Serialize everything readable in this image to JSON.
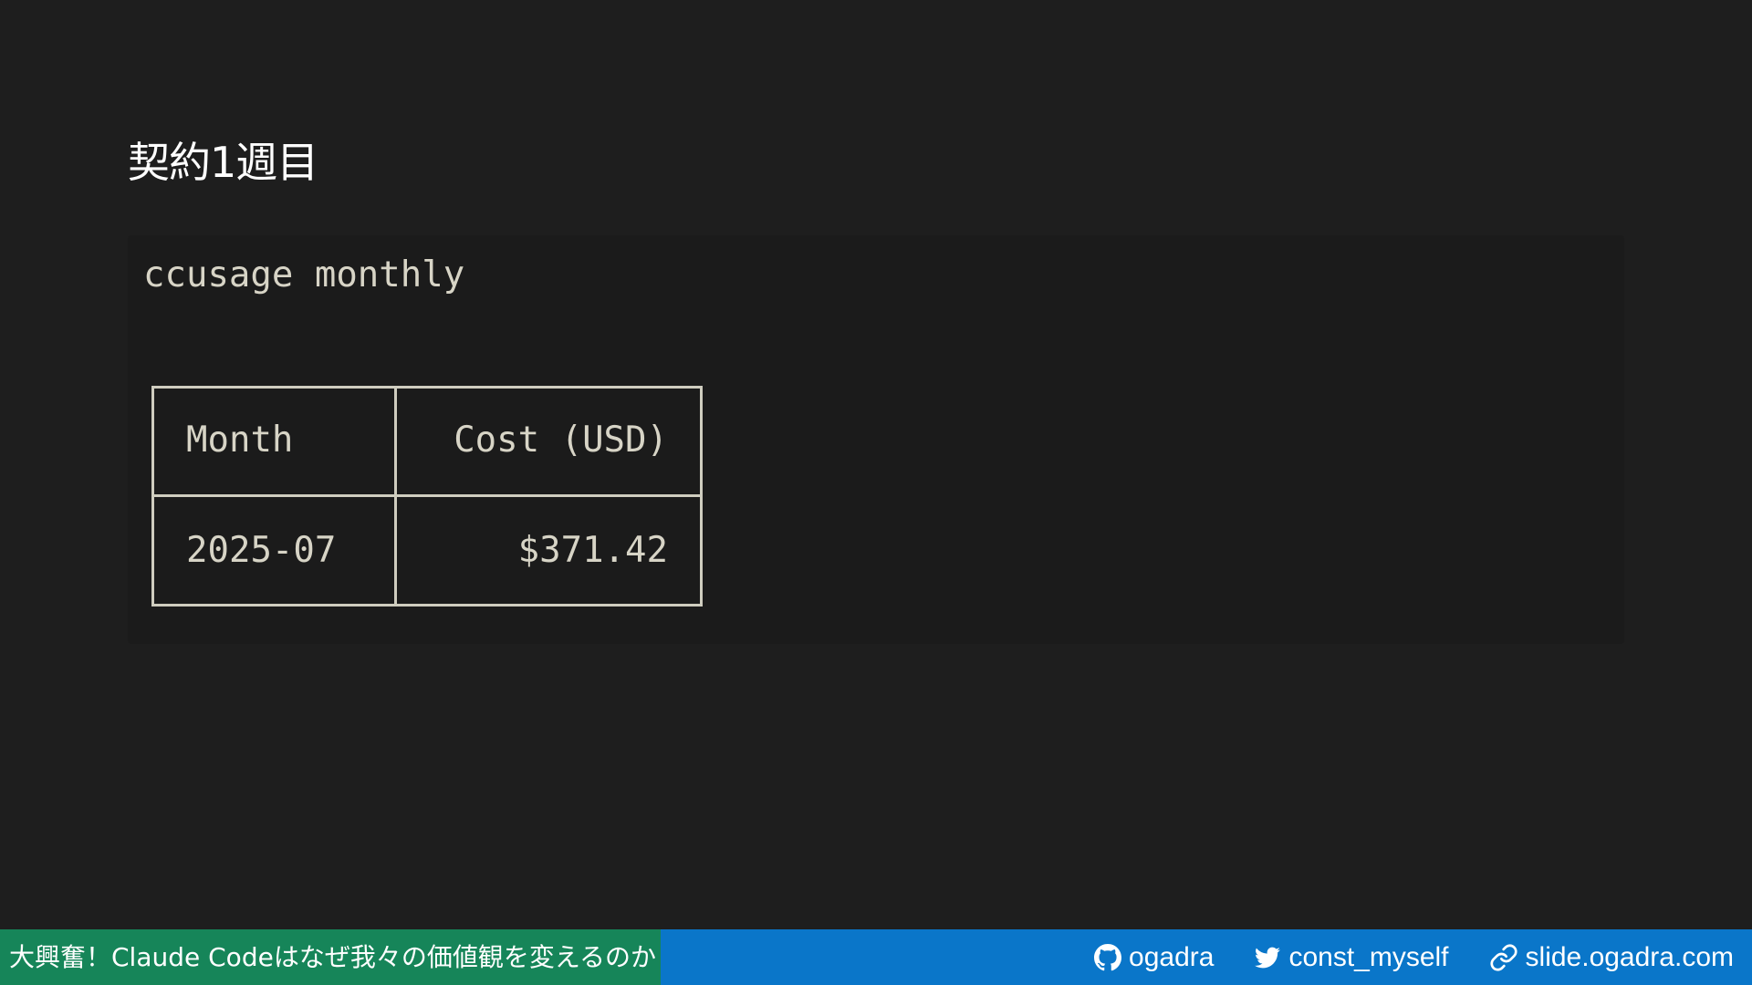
{
  "slide": {
    "title": "契約1週目"
  },
  "code": {
    "command": "ccusage monthly",
    "table": {
      "headers": [
        "Month",
        "Cost (USD)"
      ],
      "rows": [
        [
          "2025-07",
          "$371.42"
        ]
      ]
    }
  },
  "footer": {
    "deck_title": "大興奮！Claude Codeはなぜ我々の価値観を変えるのか",
    "links": [
      {
        "icon": "github-icon",
        "label": "ogadra"
      },
      {
        "icon": "twitter-icon",
        "label": "const_myself"
      },
      {
        "icon": "link-icon",
        "label": "slide.ogadra.com"
      }
    ]
  },
  "colors": {
    "background": "#1e1e1e",
    "code_text": "#d7d4c6",
    "footer_left": "#168559",
    "footer_right": "#0a76c9"
  }
}
